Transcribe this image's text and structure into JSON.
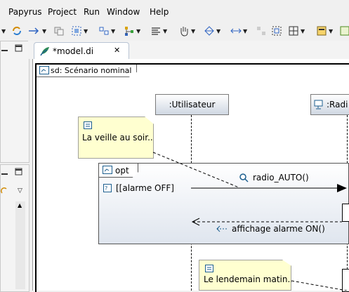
{
  "menubar": {
    "items": [
      "Papyrus",
      "Project",
      "Run",
      "Window",
      "Help"
    ]
  },
  "editor": {
    "tab_title": "*model.di",
    "tab_close": "✕"
  },
  "diagram": {
    "frame_title": "sd: Scénario nominal",
    "lifeline_user": ":Utilisateur",
    "lifeline_radio": ":Radi",
    "note_1": "La veille au soir...",
    "note_2": "Le lendemain matin...",
    "fragment_operator": "opt",
    "fragment_guard": "[[alarme OFF]",
    "message_1": "radio_AUTO()",
    "message_2": "affichage alarme ON()"
  }
}
